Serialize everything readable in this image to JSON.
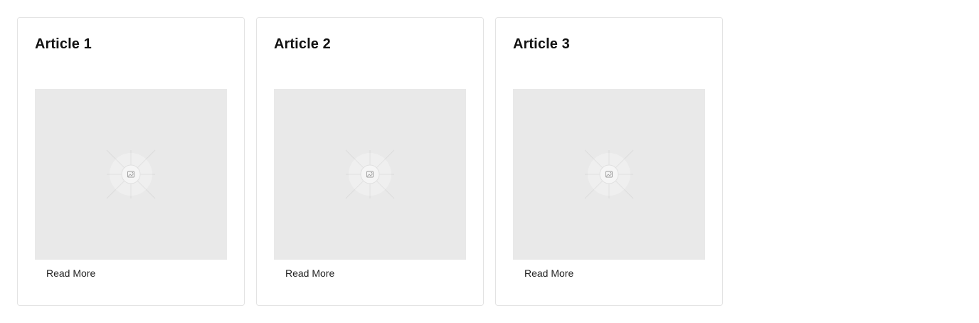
{
  "articles": [
    {
      "title": "Article 1",
      "link_label": "Read More",
      "image_icon": "image-placeholder-icon"
    },
    {
      "title": "Article 2",
      "link_label": "Read More",
      "image_icon": "image-placeholder-icon"
    },
    {
      "title": "Article 3",
      "link_label": "Read More",
      "image_icon": "image-placeholder-icon"
    }
  ],
  "colors": {
    "card_border": "#e3e3e3",
    "placeholder_bg": "#e9e9e9",
    "title_text": "#111111",
    "link_text": "#222222"
  }
}
